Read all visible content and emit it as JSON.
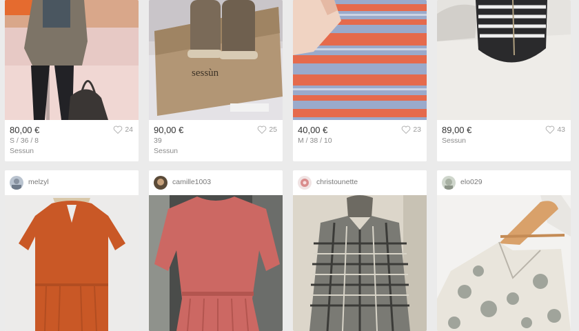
{
  "top_row": [
    {
      "price": "80,00 €",
      "size": "S / 36 / 8",
      "brand": "Sessun",
      "likes": "24"
    },
    {
      "price": "90,00 €",
      "size": "39",
      "brand": "Sessun",
      "likes": "25",
      "box_logo": "sessùn"
    },
    {
      "price": "40,00 €",
      "size": "M / 38 / 10",
      "brand": "",
      "likes": "23"
    },
    {
      "price": "89,00 €",
      "size": "Sessun",
      "brand": "",
      "likes": "43"
    }
  ],
  "bottom_row": [
    {
      "username": "melzyl"
    },
    {
      "username": "camille1003"
    },
    {
      "username": "christounette"
    },
    {
      "username": "elo029"
    }
  ],
  "icons": {
    "like": "heart-icon"
  },
  "colors": {
    "page_bg": "#ebebeb",
    "card_bg": "#ffffff",
    "price_text": "#333333",
    "meta_text": "#8a8a8a"
  }
}
